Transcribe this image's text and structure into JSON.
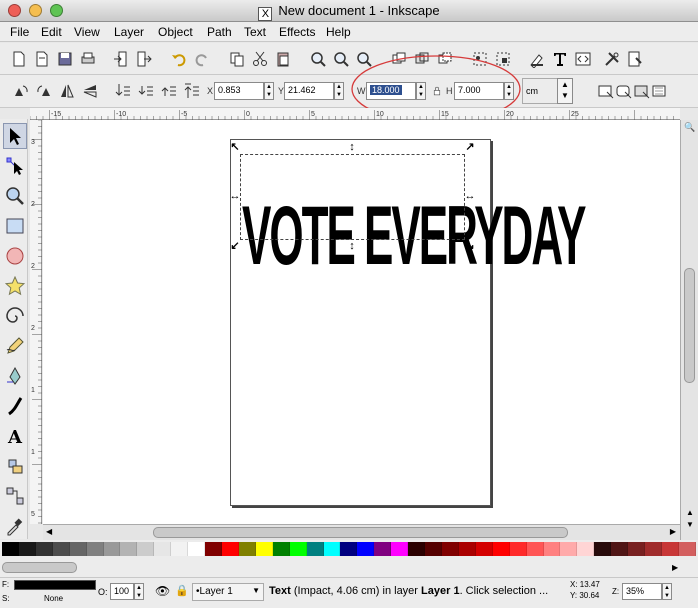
{
  "window": {
    "title": "New document 1 - Inkscape",
    "x_glyph": "X"
  },
  "menus": [
    "File",
    "Edit",
    "View",
    "Layer",
    "Object",
    "Path",
    "Text",
    "Effects",
    "Help"
  ],
  "select_toolbar": {
    "x_label": "X",
    "x_value": "0.853",
    "y_label": "Y",
    "y_value": "21.462",
    "w_label": "W",
    "w_value": "18.000",
    "h_label": "H",
    "h_value": "7.000",
    "unit": "cm"
  },
  "rulers": {
    "h_ticks": [
      "-15",
      "-10",
      "-5",
      "0",
      "5",
      "10",
      "15",
      "20",
      "25"
    ],
    "v_ticks": [
      "3",
      "2",
      "2",
      "2",
      "1",
      "1",
      "5",
      "0"
    ]
  },
  "document": {
    "text": "VOTE EVERYDAY"
  },
  "palette_colors": [
    "#000000",
    "#1a1a1a",
    "#333333",
    "#4d4d4d",
    "#666666",
    "#808080",
    "#999999",
    "#b3b3b3",
    "#cccccc",
    "#e6e6e6",
    "#f2f2f2",
    "#ffffff",
    "#800000",
    "#ff0000",
    "#808000",
    "#ffff00",
    "#008000",
    "#00ff00",
    "#008080",
    "#00ffff",
    "#000080",
    "#0000ff",
    "#800080",
    "#ff00ff",
    "#2b0000",
    "#550000",
    "#800000",
    "#aa0000",
    "#d40000",
    "#ff0000",
    "#ff2a2a",
    "#ff5555",
    "#ff8080",
    "#ffaaaa",
    "#ffd5d5",
    "#280b0b",
    "#501616",
    "#782121",
    "#a02c2c",
    "#c83737",
    "#d35f5f"
  ],
  "status": {
    "fill_label": "F:",
    "stroke_label": "S:",
    "stroke_value": "None",
    "opacity_label": "O:",
    "opacity_value": "100",
    "layer": "•Layer 1",
    "message_prefix": "Text",
    "message_mid": " (Impact, 4.06 cm) in layer ",
    "message_layer": "Layer 1",
    "message_suffix": ". Click selection ...",
    "x_coord": "X: 13.47",
    "y_coord": "Y: 30.64",
    "zoom_label": "Z:",
    "zoom": "35%"
  }
}
